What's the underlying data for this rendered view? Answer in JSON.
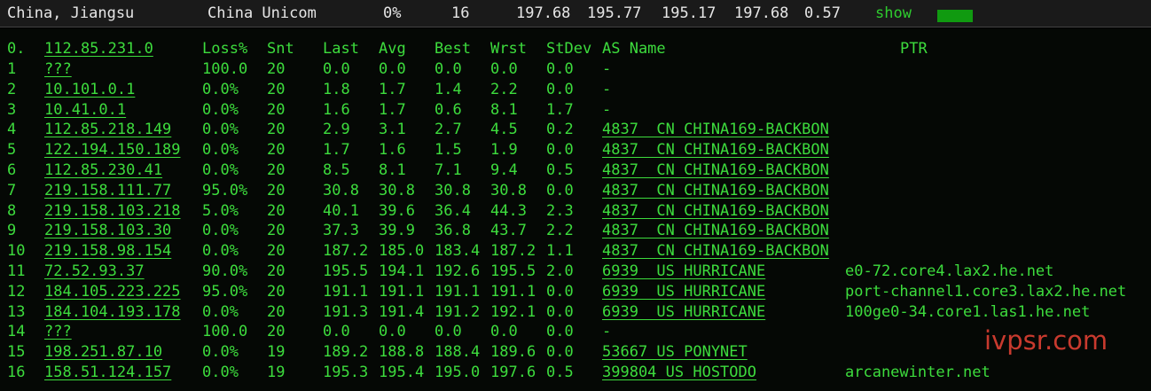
{
  "topbar": {
    "location": "China, Jiangsu",
    "isp": "China Unicom",
    "loss": "0%",
    "count": "16",
    "v1": "197.68",
    "v2": "195.77",
    "v3": "195.17",
    "v4": "197.68",
    "v5": "0.57",
    "show_label": "show"
  },
  "header": {
    "index": "0.",
    "host": "112.85.231.0",
    "loss": "Loss%",
    "snt": "Snt",
    "last": "Last",
    "avg": "Avg",
    "best": "Best",
    "wrst": "Wrst",
    "stdev": "StDev",
    "as_name": "AS Name",
    "ptr": "PTR"
  },
  "rows": [
    {
      "idx": "1",
      "host": "???",
      "loss": "100.0",
      "snt": "20",
      "last": "0.0",
      "avg": "0.0",
      "best": "0.0",
      "wrst": "0.0",
      "stdev": "0.0",
      "as": "-",
      "ptr": ""
    },
    {
      "idx": "2",
      "host": "10.101.0.1",
      "loss": "0.0%",
      "snt": "20",
      "last": "1.8",
      "avg": "1.7",
      "best": "1.4",
      "wrst": "2.2",
      "stdev": "0.0",
      "as": "-",
      "ptr": ""
    },
    {
      "idx": "3",
      "host": "10.41.0.1",
      "loss": "0.0%",
      "snt": "20",
      "last": "1.6",
      "avg": "1.7",
      "best": "0.6",
      "wrst": "8.1",
      "stdev": "1.7",
      "as": "-",
      "ptr": ""
    },
    {
      "idx": "4",
      "host": "112.85.218.149",
      "loss": "0.0%",
      "snt": "20",
      "last": "2.9",
      "avg": "3.1",
      "best": "2.7",
      "wrst": "4.5",
      "stdev": "0.2",
      "as": "4837  CN CHINA169-BACKBON",
      "ptr": ""
    },
    {
      "idx": "5",
      "host": "122.194.150.189",
      "loss": "0.0%",
      "snt": "20",
      "last": "1.7",
      "avg": "1.6",
      "best": "1.5",
      "wrst": "1.9",
      "stdev": "0.0",
      "as": "4837  CN CHINA169-BACKBON",
      "ptr": ""
    },
    {
      "idx": "6",
      "host": "112.85.230.41",
      "loss": "0.0%",
      "snt": "20",
      "last": "8.5",
      "avg": "8.1",
      "best": "7.1",
      "wrst": "9.4",
      "stdev": "0.5",
      "as": "4837  CN CHINA169-BACKBON",
      "ptr": ""
    },
    {
      "idx": "7",
      "host": "219.158.111.77",
      "loss": "95.0%",
      "snt": "20",
      "last": "30.8",
      "avg": "30.8",
      "best": "30.8",
      "wrst": "30.8",
      "stdev": "0.0",
      "as": "4837  CN CHINA169-BACKBON",
      "ptr": ""
    },
    {
      "idx": "8",
      "host": "219.158.103.218",
      "loss": "5.0%",
      "snt": "20",
      "last": "40.1",
      "avg": "39.6",
      "best": "36.4",
      "wrst": "44.3",
      "stdev": "2.3",
      "as": "4837  CN CHINA169-BACKBON",
      "ptr": ""
    },
    {
      "idx": "9",
      "host": "219.158.103.30",
      "loss": "0.0%",
      "snt": "20",
      "last": "37.3",
      "avg": "39.9",
      "best": "36.8",
      "wrst": "43.7",
      "stdev": "2.2",
      "as": "4837  CN CHINA169-BACKBON",
      "ptr": ""
    },
    {
      "idx": "10",
      "host": "219.158.98.154",
      "loss": "0.0%",
      "snt": "20",
      "last": "187.2",
      "avg": "185.0",
      "best": "183.4",
      "wrst": "187.2",
      "stdev": "1.1",
      "as": "4837  CN CHINA169-BACKBON",
      "ptr": ""
    },
    {
      "idx": "11",
      "host": "72.52.93.37",
      "loss": "90.0%",
      "snt": "20",
      "last": "195.5",
      "avg": "194.1",
      "best": "192.6",
      "wrst": "195.5",
      "stdev": "2.0",
      "as": "6939  US HURRICANE",
      "ptr": "e0-72.core4.lax2.he.net"
    },
    {
      "idx": "12",
      "host": "184.105.223.225",
      "loss": "95.0%",
      "snt": "20",
      "last": "191.1",
      "avg": "191.1",
      "best": "191.1",
      "wrst": "191.1",
      "stdev": "0.0",
      "as": "6939  US HURRICANE",
      "ptr": "port-channel1.core3.lax2.he.net"
    },
    {
      "idx": "13",
      "host": "184.104.193.178",
      "loss": "0.0%",
      "snt": "20",
      "last": "191.3",
      "avg": "191.4",
      "best": "191.2",
      "wrst": "192.1",
      "stdev": "0.0",
      "as": "6939  US HURRICANE",
      "ptr": "100ge0-34.core1.las1.he.net"
    },
    {
      "idx": "14",
      "host": "???",
      "loss": "100.0",
      "snt": "20",
      "last": "0.0",
      "avg": "0.0",
      "best": "0.0",
      "wrst": "0.0",
      "stdev": "0.0",
      "as": "-",
      "ptr": ""
    },
    {
      "idx": "15",
      "host": "198.251.87.10",
      "loss": "0.0%",
      "snt": "19",
      "last": "189.2",
      "avg": "188.8",
      "best": "188.4",
      "wrst": "189.6",
      "stdev": "0.0",
      "as": "53667 US PONYNET",
      "ptr": ""
    },
    {
      "idx": "16",
      "host": "158.51.124.157",
      "loss": "0.0%",
      "snt": "19",
      "last": "195.3",
      "avg": "195.4",
      "best": "195.0",
      "wrst": "197.6",
      "stdev": "0.5",
      "as": "399804 US HOSTODO",
      "ptr": "arcanewinter.net"
    }
  ],
  "watermark": "ivpsr.com",
  "colors": {
    "text": "#3ddc3d",
    "background": "#050805",
    "topbar_bg": "#1a1a1a",
    "watermark": "#c83a2e"
  }
}
